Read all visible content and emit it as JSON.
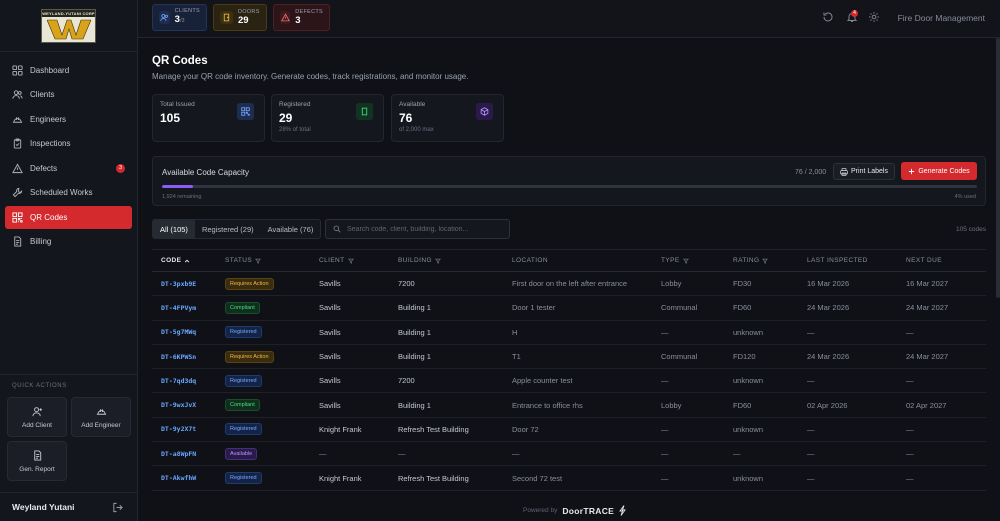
{
  "brand": {
    "logo_text": "WEYLAND-YUTANI CORP",
    "app_name": "Fire Door Management",
    "user_name": "Weyland Yutani"
  },
  "topstats": [
    {
      "label": "CLIENTS",
      "value": "3",
      "suffix": "/3"
    },
    {
      "label": "DOORS",
      "value": "29"
    },
    {
      "label": "DEFECTS",
      "value": "3"
    }
  ],
  "notifications_count": "4",
  "sidebar": {
    "items": [
      {
        "label": "Dashboard",
        "icon": "grid-icon"
      },
      {
        "label": "Clients",
        "icon": "users-icon"
      },
      {
        "label": "Engineers",
        "icon": "hardhat-icon"
      },
      {
        "label": "Inspections",
        "icon": "clipboard-icon"
      },
      {
        "label": "Defects",
        "icon": "warning-icon",
        "badge": "3"
      },
      {
        "label": "Scheduled Works",
        "icon": "wrench-icon"
      },
      {
        "label": "QR Codes",
        "icon": "qr-icon",
        "active": true
      },
      {
        "label": "Billing",
        "icon": "document-icon"
      }
    ],
    "quick_actions_title": "QUICK ACTIONS",
    "quick_actions": [
      {
        "label": "Add Client"
      },
      {
        "label": "Add Engineer"
      },
      {
        "label": "Gen. Report"
      }
    ]
  },
  "page": {
    "title": "QR Codes",
    "subtitle": "Manage your QR code inventory. Generate codes, track registrations, and monitor usage."
  },
  "kpis": [
    {
      "label": "Total Issued",
      "value": "105",
      "sub": ""
    },
    {
      "label": "Registered",
      "value": "29",
      "sub": "28% of total"
    },
    {
      "label": "Available",
      "value": "76",
      "sub": "of 2,000 max"
    }
  ],
  "capacity": {
    "title": "Available Code Capacity",
    "count": "76 / 2,000",
    "print_label": "Print Labels",
    "generate_label": "Generate Codes",
    "remaining": "1,924 remaining",
    "used": "4% used",
    "used_fraction": 0.038,
    "fill_color": "#8b5cf6"
  },
  "tabs": [
    {
      "label": "All (105)",
      "active": true
    },
    {
      "label": "Registered (29)"
    },
    {
      "label": "Available (76)"
    }
  ],
  "search": {
    "placeholder": "Search code, client, building, location..."
  },
  "total_label": "105 codes",
  "table": {
    "headers": [
      "CODE",
      "STATUS",
      "CLIENT",
      "BUILDING",
      "LOCATION",
      "TYPE",
      "RATING",
      "LAST INSPECTED",
      "NEXT DUE"
    ],
    "rows": [
      {
        "code": "DT-3pxb9E",
        "status": "Requires Action",
        "status_kind": "action",
        "client": "Savills",
        "building": "7200",
        "location": "First door on the left after entrance",
        "type": "Lobby",
        "rating": "FD30",
        "last": "16 Mar 2026",
        "next": "16 Mar 2027"
      },
      {
        "code": "DT-4FPVym",
        "status": "Compliant",
        "status_kind": "compliant",
        "client": "Savills",
        "building": "Building 1",
        "location": "Door 1 tester",
        "type": "Communal",
        "rating": "FD60",
        "last": "24 Mar 2026",
        "next": "24 Mar 2027"
      },
      {
        "code": "DT-5g7MWq",
        "status": "Registered",
        "status_kind": "registered",
        "client": "Savills",
        "building": "Building 1",
        "location": "H",
        "type": "—",
        "rating": "unknown",
        "last": "—",
        "next": "—"
      },
      {
        "code": "DT-6KPWSn",
        "status": "Requires Action",
        "status_kind": "action",
        "client": "Savills",
        "building": "Building 1",
        "location": "T1",
        "type": "Communal",
        "rating": "FD120",
        "last": "24 Mar 2026",
        "next": "24 Mar 2027"
      },
      {
        "code": "DT-7qd3dq",
        "status": "Registered",
        "status_kind": "registered",
        "client": "Savills",
        "building": "7200",
        "location": "Apple counter test",
        "type": "—",
        "rating": "unknown",
        "last": "—",
        "next": "—"
      },
      {
        "code": "DT-9wxJvX",
        "status": "Compliant",
        "status_kind": "compliant",
        "client": "Savills",
        "building": "Building 1",
        "location": "Entrance to office rhs",
        "type": "Lobby",
        "rating": "FD60",
        "last": "02 Apr 2026",
        "next": "02 Apr 2027"
      },
      {
        "code": "DT-9y2X7t",
        "status": "Registered",
        "status_kind": "registered",
        "client": "Knight Frank",
        "building": "Refresh Test Building",
        "location": "Door 72",
        "type": "—",
        "rating": "unknown",
        "last": "—",
        "next": "—"
      },
      {
        "code": "DT-a8WpFN",
        "status": "Available",
        "status_kind": "available",
        "client": "—",
        "building": "—",
        "location": "—",
        "type": "—",
        "rating": "—",
        "last": "—",
        "next": "—"
      },
      {
        "code": "DT-AkwfhW",
        "status": "Registered",
        "status_kind": "registered",
        "client": "Knight Frank",
        "building": "Refresh Test Building",
        "location": "Second 72 test",
        "type": "—",
        "rating": "unknown",
        "last": "—",
        "next": "—"
      }
    ]
  },
  "footer": {
    "powered_by": "Powered by",
    "brand": "DoorTRACE"
  },
  "colors": {
    "accent": "#d42a2e",
    "background": "#0f1117",
    "link": "#6aa7ff"
  }
}
